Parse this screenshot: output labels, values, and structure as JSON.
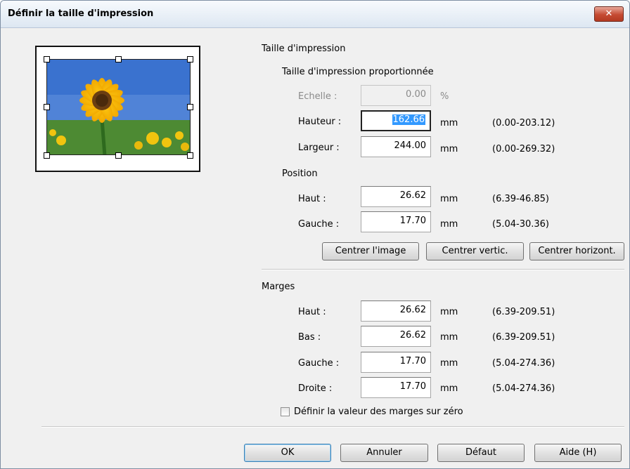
{
  "window": {
    "title": "Définir la taille d'impression",
    "close_glyph": "✕"
  },
  "print_size": {
    "heading": "Taille d'impression",
    "proportional_heading": "Taille d'impression proportionnée",
    "scale": {
      "label": "Echelle :",
      "value": "0.00",
      "unit": "%"
    },
    "height": {
      "label": "Hauteur :",
      "value": "162.66",
      "unit": "mm",
      "range": "(0.00-203.12)"
    },
    "width": {
      "label": "Largeur :",
      "value": "244.00",
      "unit": "mm",
      "range": "(0.00-269.32)"
    }
  },
  "position": {
    "heading": "Position",
    "top": {
      "label": "Haut :",
      "value": "26.62",
      "unit": "mm",
      "range": "(6.39-46.85)"
    },
    "left": {
      "label": "Gauche :",
      "value": "17.70",
      "unit": "mm",
      "range": "(5.04-30.36)"
    },
    "buttons": {
      "center_image": "Centrer l'image",
      "center_vertical": "Centrer vertic.",
      "center_horizontal": "Centrer horizont."
    }
  },
  "margins": {
    "heading": "Marges",
    "top": {
      "label": "Haut :",
      "value": "26.62",
      "unit": "mm",
      "range": "(6.39-209.51)"
    },
    "bottom": {
      "label": "Bas :",
      "value": "26.62",
      "unit": "mm",
      "range": "(6.39-209.51)"
    },
    "left": {
      "label": "Gauche :",
      "value": "17.70",
      "unit": "mm",
      "range": "(5.04-274.36)"
    },
    "right": {
      "label": "Droite :",
      "value": "17.70",
      "unit": "mm",
      "range": "(5.04-274.36)"
    },
    "zero_checkbox": {
      "label": "Définir la valeur des marges sur zéro",
      "checked": false
    }
  },
  "footer": {
    "ok": "OK",
    "cancel": "Annuler",
    "default": "Défaut",
    "help": "Aide (H)"
  },
  "colors": {
    "selection": "#3399ff",
    "default_button_border": "#3c7fb1"
  }
}
